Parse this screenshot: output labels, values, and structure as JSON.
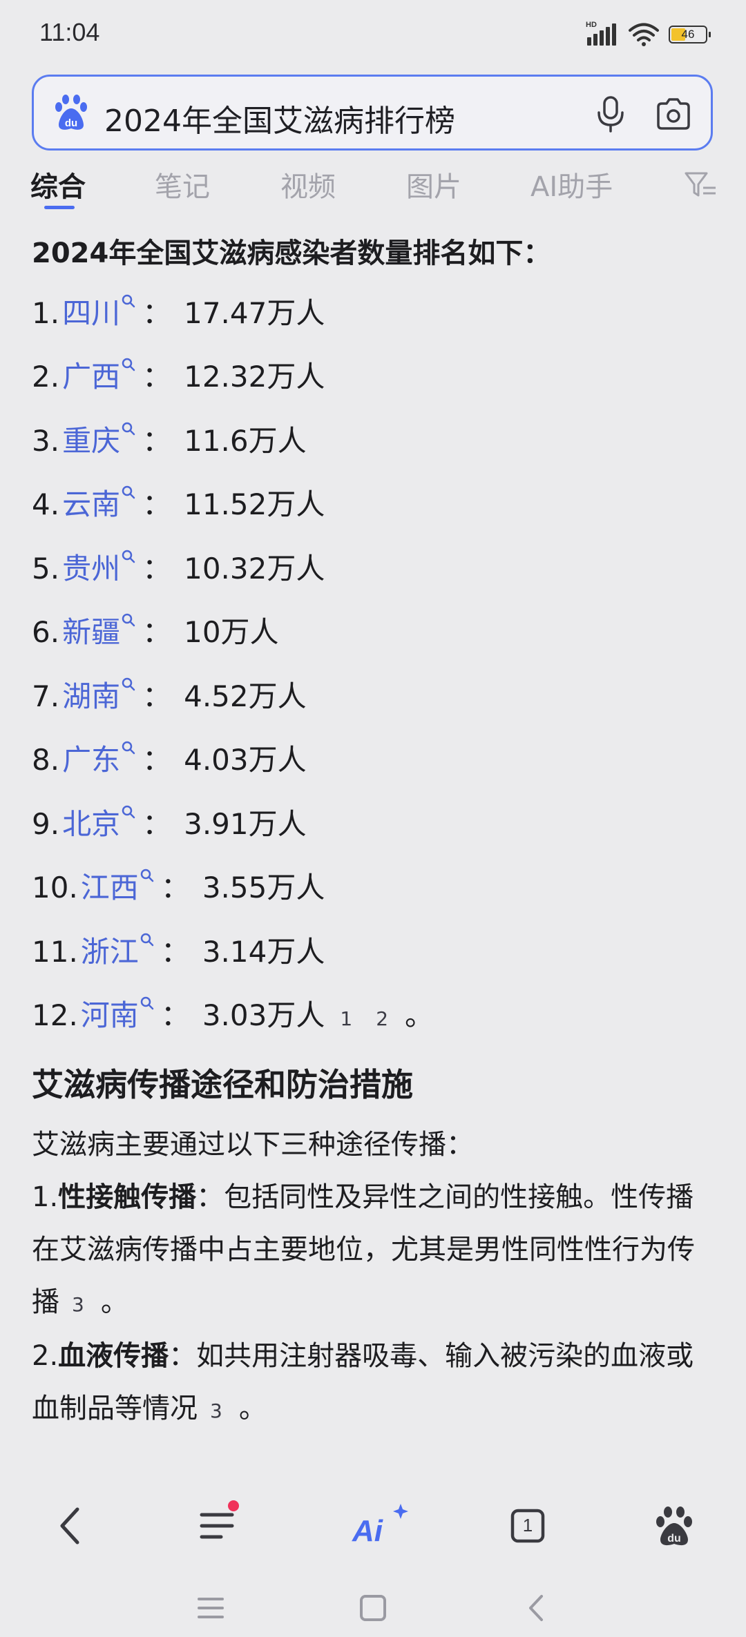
{
  "status_bar": {
    "time": "11:04",
    "hd_label": "HD",
    "battery_level": "46",
    "icons": [
      "signal-icon",
      "wifi-icon",
      "battery-icon"
    ]
  },
  "search": {
    "query": "2024年全国艾滋病排行榜",
    "icons": [
      "baidu-logo-icon",
      "mic-icon",
      "camera-icon"
    ]
  },
  "tabs": [
    {
      "label": "综合",
      "active": true
    },
    {
      "label": "笔记",
      "active": false
    },
    {
      "label": "视频",
      "active": false
    },
    {
      "label": "图片",
      "active": false
    },
    {
      "label": "AI助手",
      "active": false
    }
  ],
  "content": {
    "intro": "2024年全国艾滋病感染者数量排名如下：",
    "ranking": [
      {
        "num": "1.",
        "province": "四川",
        "value": "17.47万人"
      },
      {
        "num": "2.",
        "province": "广西",
        "value": "12.32万人"
      },
      {
        "num": "3.",
        "province": "重庆",
        "value": "11.6万人"
      },
      {
        "num": "4.",
        "province": "云南",
        "value": "11.52万人"
      },
      {
        "num": "5.",
        "province": "贵州",
        "value": "10.32万人"
      },
      {
        "num": "6.",
        "province": "新疆",
        "value": "10万人"
      },
      {
        "num": "7.",
        "province": "湖南",
        "value": "4.52万人"
      },
      {
        "num": "8.",
        "province": "广东",
        "value": "4.03万人"
      },
      {
        "num": "9.",
        "province": "北京",
        "value": "3.91万人"
      },
      {
        "num": "10.",
        "province": "江西",
        "value": "3.55万人"
      },
      {
        "num": "11.",
        "province": "浙江",
        "value": "3.14万人"
      },
      {
        "num": "12.",
        "province": "河南",
        "value": "3.03万人"
      }
    ],
    "colon": "：",
    "last_citations": [
      "1",
      "2"
    ],
    "period": "。",
    "section_title": "艾滋病传播途径和防治措施",
    "section_intro": "艾滋病主要通过以下三种途径传播：",
    "point1_num": "1.",
    "point1_title": "性接触传播",
    "point1_text": "：包括同性及异性之间的性接触。性传播在艾滋病传播中占主要地位，尤其是男性同性性行为传播",
    "point1_cite": "3",
    "point2_num": "2.",
    "point2_title": "血液传播",
    "point2_text": "：如共用注射器吸毒、输入被污染的血液或血制品等情况",
    "point2_cite": "3"
  },
  "bottom_bar": {
    "tab_count": "1",
    "icons": [
      "back-icon",
      "menu-icon",
      "ai-icon",
      "tabs-icon",
      "baidu-home-icon"
    ],
    "accent_color": "#4a6cf0",
    "badge_color": "#f0325a"
  },
  "nav_bar": {
    "icons": [
      "recent-apps-icon",
      "home-icon",
      "system-back-icon"
    ]
  }
}
